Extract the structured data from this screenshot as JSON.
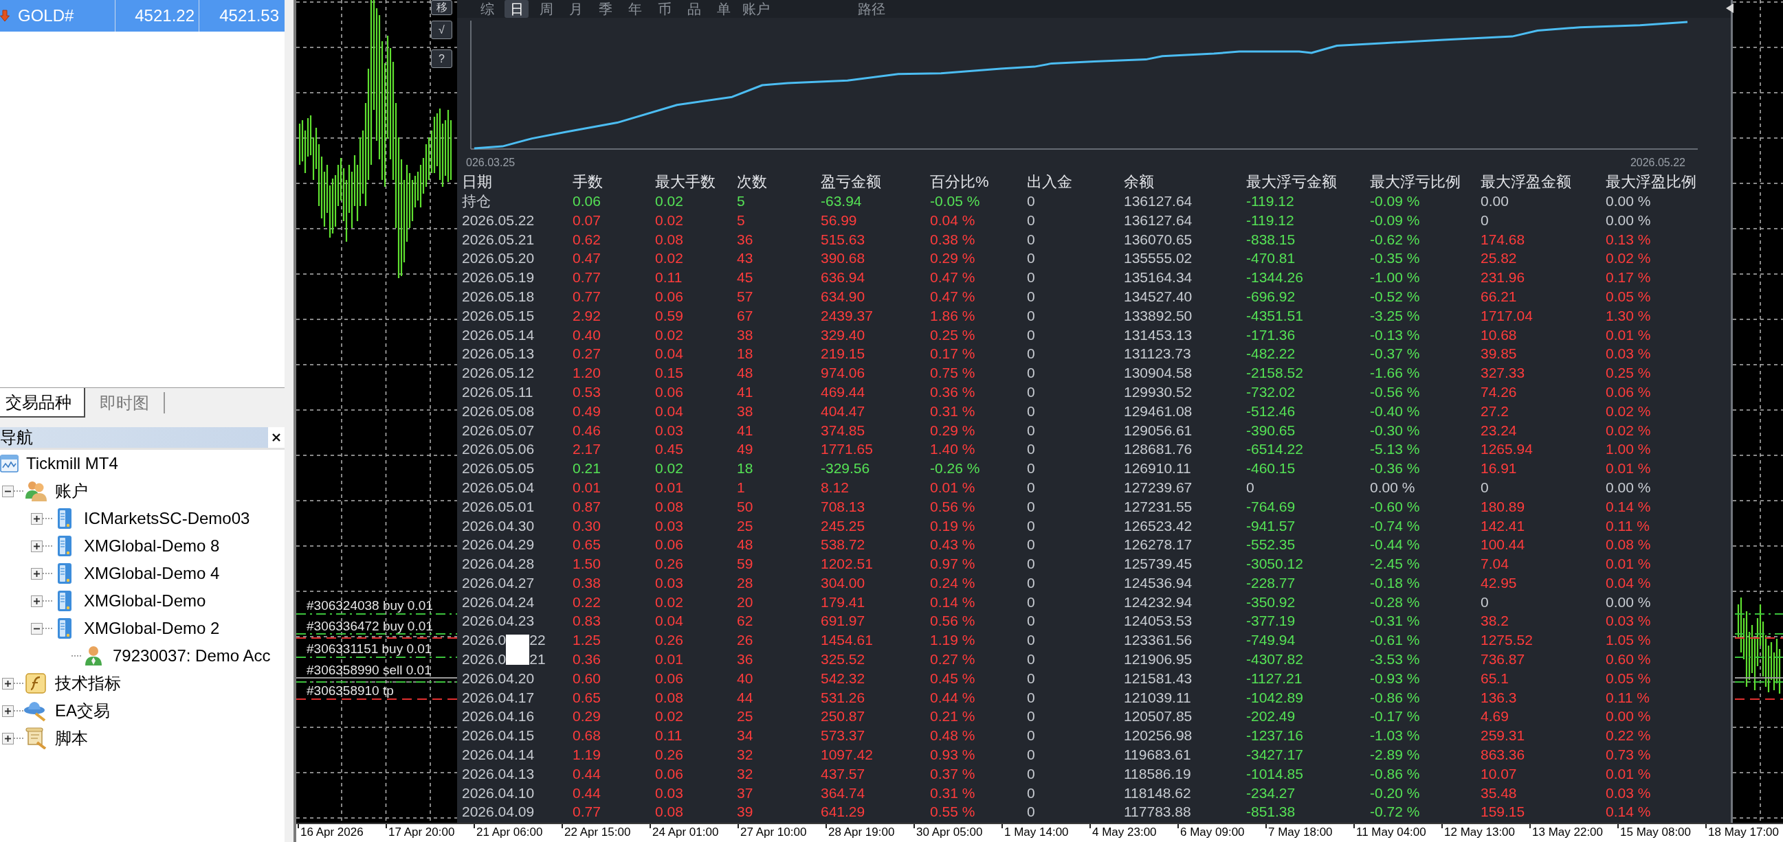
{
  "market_watch": {
    "rows": [
      {
        "symbol": "GOLD#",
        "bid": "4521.22",
        "ask": "4521.53",
        "selected": true,
        "price_down": true
      }
    ]
  },
  "panel_tabs": [
    {
      "label": "交易品种",
      "selected": true
    },
    {
      "label": "即时图",
      "selected": false
    }
  ],
  "navigator": {
    "title": "导航",
    "tree": [
      {
        "label": "Tickmill MT4",
        "kind": "terminal",
        "children": [
          {
            "label": "账户",
            "kind": "accounts",
            "expanded": true,
            "children": [
              {
                "label": "ICMarketsSC-Demo03",
                "kind": "server",
                "expanded": false
              },
              {
                "label": "XMGlobal-Demo 8",
                "kind": "server",
                "expanded": false
              },
              {
                "label": "XMGlobal-Demo 4",
                "kind": "server",
                "expanded": false
              },
              {
                "label": "XMGlobal-Demo",
                "kind": "server",
                "expanded": false
              },
              {
                "label": "XMGlobal-Demo 2",
                "kind": "server",
                "expanded": true,
                "children": [
                  {
                    "label": "79230037: Demo Acc",
                    "kind": "account"
                  }
                ]
              }
            ]
          },
          {
            "label": "技术指标",
            "kind": "indicators",
            "expanded": false
          },
          {
            "label": "EA交易",
            "kind": "experts",
            "expanded": false
          },
          {
            "label": "脚本",
            "kind": "scripts",
            "expanded": false
          }
        ]
      }
    ]
  },
  "chart": {
    "order_labels": [
      "#306324038 buy 0.01",
      "#306336472 buy 0.01",
      "#306331151 buy 0.01",
      "#306358990 sell 0.01",
      "#306358910 tp"
    ],
    "time_axis": [
      "16 Apr 2026",
      "17 Apr 20:00",
      "21 Apr 06:00",
      "22 Apr 15:00",
      "24 Apr 01:00",
      "27 Apr 10:00",
      "28 Apr 19:00",
      "30 Apr 05:00",
      "1 May 14:00",
      "4 May 23:00",
      "6 May 09:00",
      "7 May 18:00",
      "11 May 04:00",
      "12 May 13:00",
      "13 May 22:00",
      "15 May 08:00",
      "18 May 17:00"
    ]
  },
  "report": {
    "buttons": [
      "移",
      "√",
      "?"
    ],
    "tabs": [
      {
        "label": "综",
        "selected": false
      },
      {
        "label": "日",
        "selected": true
      },
      {
        "label": "周",
        "selected": false
      },
      {
        "label": "月",
        "selected": false
      },
      {
        "label": "季",
        "selected": false
      },
      {
        "label": "年",
        "selected": false
      },
      {
        "label": "币",
        "selected": false
      },
      {
        "label": "品",
        "selected": false
      },
      {
        "label": "单",
        "selected": false
      },
      {
        "label": "账户",
        "selected": false
      },
      {
        "label": "路径",
        "selected": false
      }
    ],
    "equity_chart": {
      "start_label": "026.03.25",
      "end_label": "2026.05.22"
    },
    "table": {
      "columns": [
        "日期",
        "手数",
        "最大手数",
        "次数",
        "盈亏金额",
        "百分比%",
        "出入金",
        "余额",
        "最大浮亏金额",
        "最大浮亏比例",
        "最大浮盈金额",
        "最大浮盈比例"
      ],
      "rows": [
        {
          "cells": [
            "持仓",
            "0.06",
            "0.02",
            "5",
            "-63.94",
            "-0.05 %",
            "0",
            "136127.64",
            "-119.12",
            "-0.09 %",
            "0.00",
            "0.00 %"
          ],
          "trade_loss": true,
          "drawdown_flat": false,
          "runup_flat": true
        },
        {
          "cells": [
            "2026.05.22",
            "0.07",
            "0.02",
            "5",
            "56.99",
            "0.04 %",
            "0",
            "136127.64",
            "-119.12",
            "-0.09 %",
            "0",
            "0.00 %"
          ],
          "trade_loss": false,
          "drawdown_flat": false,
          "runup_flat": true
        },
        {
          "cells": [
            "2026.05.21",
            "0.62",
            "0.08",
            "36",
            "515.63",
            "0.38 %",
            "0",
            "136070.65",
            "-838.15",
            "-0.62 %",
            "174.68",
            "0.13 %"
          ],
          "trade_loss": false,
          "drawdown_flat": false,
          "runup_flat": false
        },
        {
          "cells": [
            "2026.05.20",
            "0.47",
            "0.02",
            "43",
            "390.68",
            "0.29 %",
            "0",
            "135555.02",
            "-470.81",
            "-0.35 %",
            "25.82",
            "0.02 %"
          ],
          "trade_loss": false,
          "drawdown_flat": false,
          "runup_flat": false
        },
        {
          "cells": [
            "2026.05.19",
            "0.77",
            "0.11",
            "45",
            "636.94",
            "0.47 %",
            "0",
            "135164.34",
            "-1344.26",
            "-1.00 %",
            "231.96",
            "0.17 %"
          ],
          "trade_loss": false,
          "drawdown_flat": false,
          "runup_flat": false
        },
        {
          "cells": [
            "2026.05.18",
            "0.77",
            "0.06",
            "57",
            "634.90",
            "0.47 %",
            "0",
            "134527.40",
            "-696.92",
            "-0.52 %",
            "66.21",
            "0.05 %"
          ],
          "trade_loss": false,
          "drawdown_flat": false,
          "runup_flat": false
        },
        {
          "cells": [
            "2026.05.15",
            "2.92",
            "0.59",
            "67",
            "2439.37",
            "1.86 %",
            "0",
            "133892.50",
            "-4351.51",
            "-3.25 %",
            "1717.04",
            "1.30 %"
          ],
          "trade_loss": false,
          "drawdown_flat": false,
          "runup_flat": false
        },
        {
          "cells": [
            "2026.05.14",
            "0.40",
            "0.02",
            "38",
            "329.40",
            "0.25 %",
            "0",
            "131453.13",
            "-171.36",
            "-0.13 %",
            "10.68",
            "0.01 %"
          ],
          "trade_loss": false,
          "drawdown_flat": false,
          "runup_flat": false
        },
        {
          "cells": [
            "2026.05.13",
            "0.27",
            "0.04",
            "18",
            "219.15",
            "0.17 %",
            "0",
            "131123.73",
            "-482.22",
            "-0.37 %",
            "39.85",
            "0.03 %"
          ],
          "trade_loss": false,
          "drawdown_flat": false,
          "runup_flat": false
        },
        {
          "cells": [
            "2026.05.12",
            "1.20",
            "0.15",
            "48",
            "974.06",
            "0.75 %",
            "0",
            "130904.58",
            "-2158.52",
            "-1.66 %",
            "327.33",
            "0.25 %"
          ],
          "trade_loss": false,
          "drawdown_flat": false,
          "runup_flat": false
        },
        {
          "cells": [
            "2026.05.11",
            "0.53",
            "0.06",
            "41",
            "469.44",
            "0.36 %",
            "0",
            "129930.52",
            "-732.02",
            "-0.56 %",
            "74.26",
            "0.06 %"
          ],
          "trade_loss": false,
          "drawdown_flat": false,
          "runup_flat": false
        },
        {
          "cells": [
            "2026.05.08",
            "0.49",
            "0.04",
            "38",
            "404.47",
            "0.31 %",
            "0",
            "129461.08",
            "-512.46",
            "-0.40 %",
            "27.2",
            "0.02 %"
          ],
          "trade_loss": false,
          "drawdown_flat": false,
          "runup_flat": false
        },
        {
          "cells": [
            "2026.05.07",
            "0.46",
            "0.03",
            "41",
            "374.85",
            "0.29 %",
            "0",
            "129056.61",
            "-390.65",
            "-0.30 %",
            "23.24",
            "0.02 %"
          ],
          "trade_loss": false,
          "drawdown_flat": false,
          "runup_flat": false
        },
        {
          "cells": [
            "2026.05.06",
            "2.17",
            "0.45",
            "49",
            "1771.65",
            "1.40 %",
            "0",
            "128681.76",
            "-6514.22",
            "-5.13 %",
            "1265.94",
            "1.00 %"
          ],
          "trade_loss": false,
          "drawdown_flat": false,
          "runup_flat": false
        },
        {
          "cells": [
            "2026.05.05",
            "0.21",
            "0.02",
            "18",
            "-329.56",
            "-0.26 %",
            "0",
            "126910.11",
            "-460.15",
            "-0.36 %",
            "16.91",
            "0.01 %"
          ],
          "trade_loss": true,
          "drawdown_flat": false,
          "runup_flat": false
        },
        {
          "cells": [
            "2026.05.04",
            "0.01",
            "0.01",
            "1",
            "8.12",
            "0.01 %",
            "0",
            "127239.67",
            "0",
            "0.00 %",
            "0",
            "0.00 %"
          ],
          "trade_loss": false,
          "drawdown_flat": true,
          "runup_flat": true
        },
        {
          "cells": [
            "2026.05.01",
            "0.87",
            "0.08",
            "50",
            "708.13",
            "0.56 %",
            "0",
            "127231.55",
            "-764.69",
            "-0.60 %",
            "180.89",
            "0.14 %"
          ],
          "trade_loss": false,
          "drawdown_flat": false,
          "runup_flat": false
        },
        {
          "cells": [
            "2026.04.30",
            "0.30",
            "0.03",
            "25",
            "245.25",
            "0.19 %",
            "0",
            "126523.42",
            "-941.57",
            "-0.74 %",
            "142.41",
            "0.11 %"
          ],
          "trade_loss": false,
          "drawdown_flat": false,
          "runup_flat": false
        },
        {
          "cells": [
            "2026.04.29",
            "0.65",
            "0.06",
            "48",
            "538.72",
            "0.43 %",
            "0",
            "126278.17",
            "-552.35",
            "-0.44 %",
            "100.44",
            "0.08 %"
          ],
          "trade_loss": false,
          "drawdown_flat": false,
          "runup_flat": false
        },
        {
          "cells": [
            "2026.04.28",
            "1.50",
            "0.26",
            "59",
            "1202.51",
            "0.97 %",
            "0",
            "125739.45",
            "-3050.12",
            "-2.45 %",
            "7.04",
            "0.01 %"
          ],
          "trade_loss": false,
          "drawdown_flat": false,
          "runup_flat": false
        },
        {
          "cells": [
            "2026.04.27",
            "0.38",
            "0.03",
            "28",
            "304.00",
            "0.24 %",
            "0",
            "124536.94",
            "-228.77",
            "-0.18 %",
            "42.95",
            "0.04 %"
          ],
          "trade_loss": false,
          "drawdown_flat": false,
          "runup_flat": false
        },
        {
          "cells": [
            "2026.04.24",
            "0.22",
            "0.02",
            "20",
            "179.41",
            "0.14 %",
            "0",
            "124232.94",
            "-350.92",
            "-0.28 %",
            "0",
            "0.00 %"
          ],
          "trade_loss": false,
          "drawdown_flat": false,
          "runup_flat": true
        },
        {
          "cells": [
            "2026.04.23",
            "0.83",
            "0.04",
            "62",
            "691.97",
            "0.56 %",
            "0",
            "124053.53",
            "-377.19",
            "-0.31 %",
            "38.2",
            "0.03 %"
          ],
          "trade_loss": false,
          "drawdown_flat": false,
          "runup_flat": false
        },
        {
          "cells": [
            "2026.0",
            "1.25",
            "0.26",
            "26",
            "1454.61",
            "1.19 %",
            "0",
            "123361.56",
            "-749.94",
            "-0.61 %",
            "1275.52",
            "1.05 %"
          ],
          "date_tail": "22",
          "trade_loss": false,
          "drawdown_flat": false,
          "runup_flat": false
        },
        {
          "cells": [
            "2026.0",
            "0.36",
            "0.01",
            "36",
            "325.52",
            "0.27 %",
            "0",
            "121906.95",
            "-4307.82",
            "-3.53 %",
            "736.87",
            "0.60 %"
          ],
          "date_tail": "21",
          "trade_loss": false,
          "drawdown_flat": false,
          "runup_flat": false
        },
        {
          "cells": [
            "2026.04.20",
            "0.60",
            "0.06",
            "40",
            "542.32",
            "0.45 %",
            "0",
            "121581.43",
            "-1127.21",
            "-0.93 %",
            "65.1",
            "0.05 %"
          ],
          "trade_loss": false,
          "drawdown_flat": false,
          "runup_flat": false
        },
        {
          "cells": [
            "2026.04.17",
            "0.65",
            "0.08",
            "44",
            "531.26",
            "0.44 %",
            "0",
            "121039.11",
            "-1042.89",
            "-0.86 %",
            "136.3",
            "0.11 %"
          ],
          "trade_loss": false,
          "drawdown_flat": false,
          "runup_flat": false
        },
        {
          "cells": [
            "2026.04.16",
            "0.29",
            "0.02",
            "25",
            "250.87",
            "0.21 %",
            "0",
            "120507.85",
            "-202.49",
            "-0.17 %",
            "4.69",
            "0.00 %"
          ],
          "trade_loss": false,
          "drawdown_flat": false,
          "runup_flat": false
        },
        {
          "cells": [
            "2026.04.15",
            "0.68",
            "0.11",
            "34",
            "573.37",
            "0.48 %",
            "0",
            "120256.98",
            "-1237.16",
            "-1.03 %",
            "259.31",
            "0.22 %"
          ],
          "trade_loss": false,
          "drawdown_flat": false,
          "runup_flat": false
        },
        {
          "cells": [
            "2026.04.14",
            "1.19",
            "0.26",
            "32",
            "1097.42",
            "0.93 %",
            "0",
            "119683.61",
            "-3427.17",
            "-2.89 %",
            "863.36",
            "0.73 %"
          ],
          "trade_loss": false,
          "drawdown_flat": false,
          "runup_flat": false
        },
        {
          "cells": [
            "2026.04.13",
            "0.44",
            "0.06",
            "32",
            "437.57",
            "0.37 %",
            "0",
            "118586.19",
            "-1014.85",
            "-0.86 %",
            "10.07",
            "0.01 %"
          ],
          "trade_loss": false,
          "drawdown_flat": false,
          "runup_flat": false
        },
        {
          "cells": [
            "2026.04.10",
            "0.44",
            "0.03",
            "37",
            "364.74",
            "0.31 %",
            "0",
            "118148.62",
            "-234.27",
            "-0.20 %",
            "35.48",
            "0.03 %"
          ],
          "trade_loss": false,
          "drawdown_flat": false,
          "runup_flat": false
        },
        {
          "cells": [
            "2026.04.09",
            "0.77",
            "0.08",
            "39",
            "641.29",
            "0.55 %",
            "0",
            "117783.88",
            "-851.38",
            "-0.72 %",
            "159.15",
            "0.14 %"
          ],
          "trade_loss": false,
          "drawdown_flat": false,
          "runup_flat": false
        }
      ]
    }
  }
}
